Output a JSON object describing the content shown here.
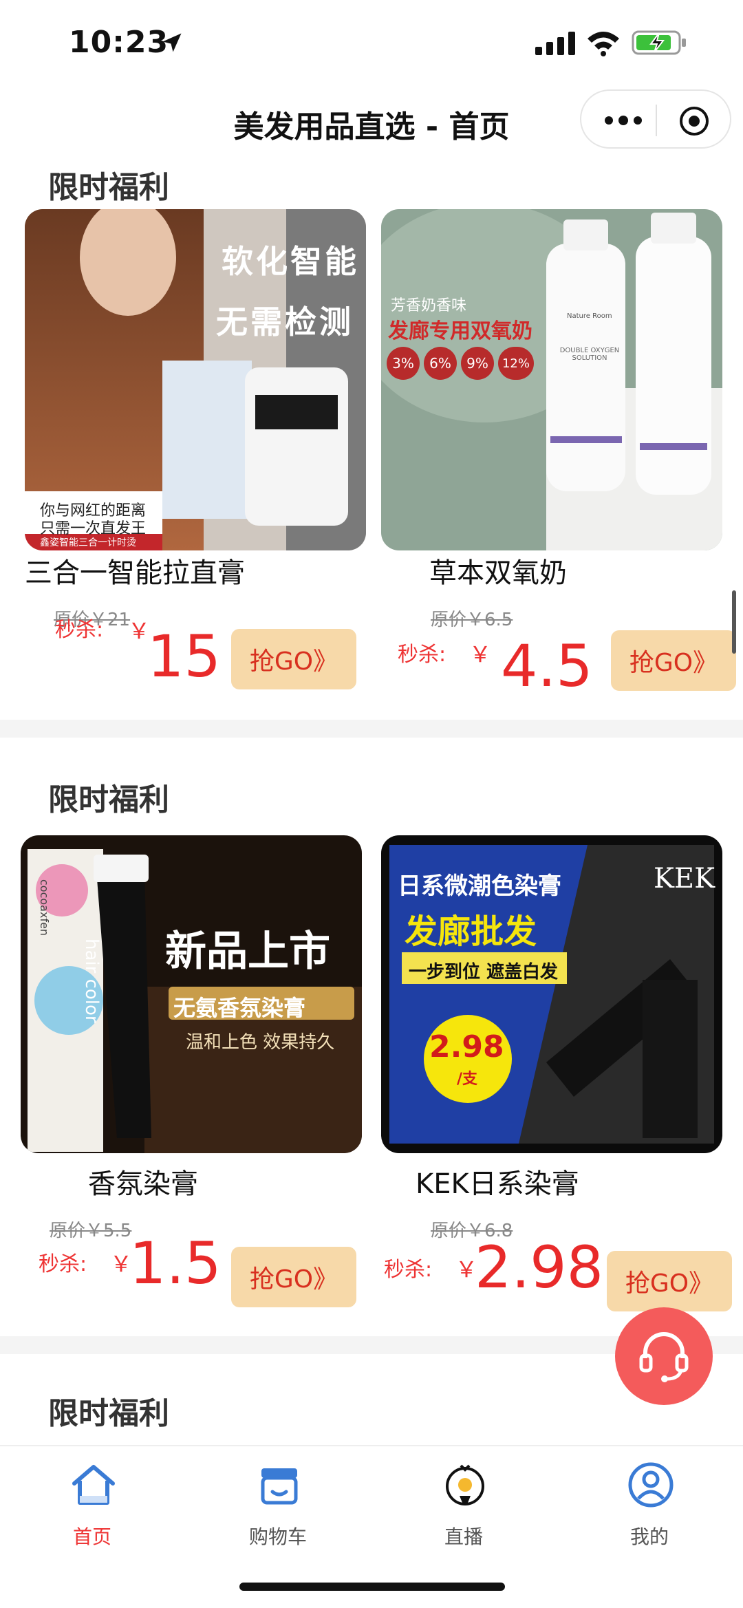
{
  "status_bar": {
    "time": "10:23"
  },
  "header": {
    "title": "美发用品直选 - 首页"
  },
  "sections": [
    {
      "title": "限时福利",
      "products": [
        {
          "name": "三合一智能拉直膏",
          "image_texts": [
            "软化智能",
            "无需检测",
            "你与网红的距离",
            "只需一次直发王",
            "鑫姿智能三合一计时烫"
          ],
          "original_price": "原价￥21",
          "seckill_label": "秒杀:",
          "currency": "￥",
          "price": "15",
          "button": "抢GO》"
        },
        {
          "name": "草本双氧奶",
          "image_texts": [
            "芳香奶香味",
            "发廊专用双氧奶",
            "3%",
            "6%",
            "9%",
            "12%",
            "Nature Room",
            "DOUBLE OXYGEN SOLUTION"
          ],
          "original_price": "原价￥6.5",
          "seckill_label": "秒杀:",
          "currency": "￥",
          "price": "4.5",
          "button": "抢GO》"
        }
      ]
    },
    {
      "title": "限时福利",
      "products": [
        {
          "name": "香氛染膏",
          "image_texts": [
            "新品上市",
            "无氨香氛染膏",
            "温和上色 效果持久",
            "hair color",
            "cocoaxfen"
          ],
          "original_price": "原价￥5.5",
          "seckill_label": "秒杀:",
          "currency": "￥",
          "price": "1.5",
          "button": "抢GO》"
        },
        {
          "name": "KEK日系染膏",
          "image_texts": [
            "日系微潮色染膏",
            "发廊批发",
            "一步到位 遮盖白发",
            "2.98",
            "/支",
            "KEK"
          ],
          "original_price": "原价￥6.8",
          "seckill_label": "秒杀:",
          "currency": "￥",
          "price": "2.98",
          "button": "抢GO》"
        }
      ]
    },
    {
      "title": "限时福利"
    }
  ],
  "tabs": [
    {
      "label": "首页",
      "icon": "home-icon",
      "active": true
    },
    {
      "label": "购物车",
      "icon": "shop-icon",
      "active": false
    },
    {
      "label": "直播",
      "icon": "live-icon",
      "active": false
    },
    {
      "label": "我的",
      "icon": "user-icon",
      "active": false
    }
  ],
  "colors": {
    "accent": "#e82a2a",
    "button_bg": "#f7d9a9",
    "tab_icon": "#3a7bd5",
    "float_button": "#f45b5b"
  }
}
